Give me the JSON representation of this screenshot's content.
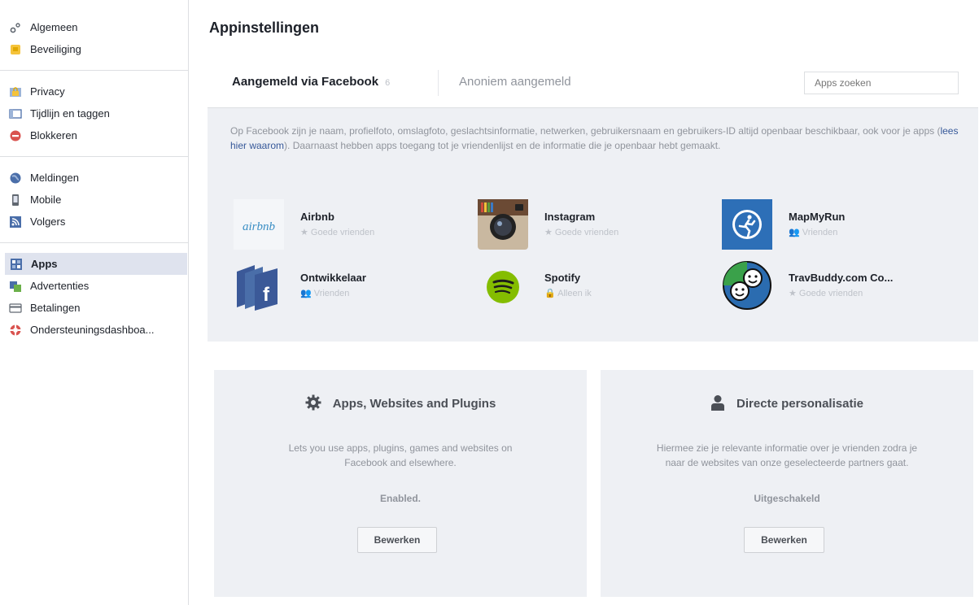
{
  "sidebar": {
    "items": [
      {
        "label": "Algemeen",
        "icon": "gears-icon"
      },
      {
        "label": "Beveiliging",
        "icon": "badge-icon"
      },
      {
        "label": "Privacy",
        "icon": "lock-icon"
      },
      {
        "label": "Tijdlijn en taggen",
        "icon": "timeline-icon"
      },
      {
        "label": "Blokkeren",
        "icon": "block-icon"
      },
      {
        "label": "Meldingen",
        "icon": "globe-icon"
      },
      {
        "label": "Mobile",
        "icon": "phone-icon"
      },
      {
        "label": "Volgers",
        "icon": "rss-icon"
      },
      {
        "label": "Apps",
        "icon": "apps-icon"
      },
      {
        "label": "Advertenties",
        "icon": "ads-icon"
      },
      {
        "label": "Betalingen",
        "icon": "card-icon"
      },
      {
        "label": "Ondersteuningsdashboa...",
        "icon": "lifebuoy-icon"
      }
    ],
    "active": "Apps"
  },
  "page": {
    "title": "Appinstellingen"
  },
  "tabs": {
    "logged_in": "Aangemeld via Facebook",
    "count": "6",
    "anonymous": "Anoniem aangemeld",
    "search_placeholder": "Apps zoeken"
  },
  "description": {
    "before_link": "Op Facebook zijn je naam, profielfoto, omslagfoto, geslachtsinformatie, netwerken, gebruikersnaam en gebruikers-ID altijd openbaar beschikbaar, ook voor je apps (",
    "link": "lees hier waarom",
    "after_link": "). Daarnaast hebben apps toegang tot je vriendenlijst en de informatie die je openbaar hebt gemaakt."
  },
  "apps": [
    {
      "name": "Airbnb",
      "visibility": "Goede vrienden",
      "vis_icon": "star-icon",
      "logo_text": "airbnb"
    },
    {
      "name": "Instagram",
      "visibility": "Goede vrienden",
      "vis_icon": "star-icon"
    },
    {
      "name": "MapMyRun",
      "visibility": "Vrienden",
      "vis_icon": "friends-icon"
    },
    {
      "name": "Ontwikkelaar",
      "visibility": "Vrienden",
      "vis_icon": "friends-icon"
    },
    {
      "name": "Spotify",
      "visibility": "Alleen ik",
      "vis_icon": "lock-icon"
    },
    {
      "name": "TravBuddy.com Co...",
      "visibility": "Goede vrienden",
      "vis_icon": "star-icon"
    }
  ],
  "cards": [
    {
      "title": "Apps, Websites and Plugins",
      "icon": "gear-icon",
      "description_lines": [
        "Lets you use apps, plugins, games and websites on",
        "Facebook and elsewhere."
      ],
      "status": "Enabled.",
      "button": "Bewerken"
    },
    {
      "title": "Directe personalisatie",
      "icon": "person-icon",
      "description_lines": [
        "Hiermee zie je relevante informatie over je vrienden zodra je",
        "naar de websites van onze geselecteerde partners gaat."
      ],
      "status": "Uitgeschakeld",
      "button": "Bewerken"
    }
  ],
  "colors": {
    "link": "#365899",
    "panel_bg": "#eef0f4",
    "active_bg": "#dfe3ee"
  }
}
